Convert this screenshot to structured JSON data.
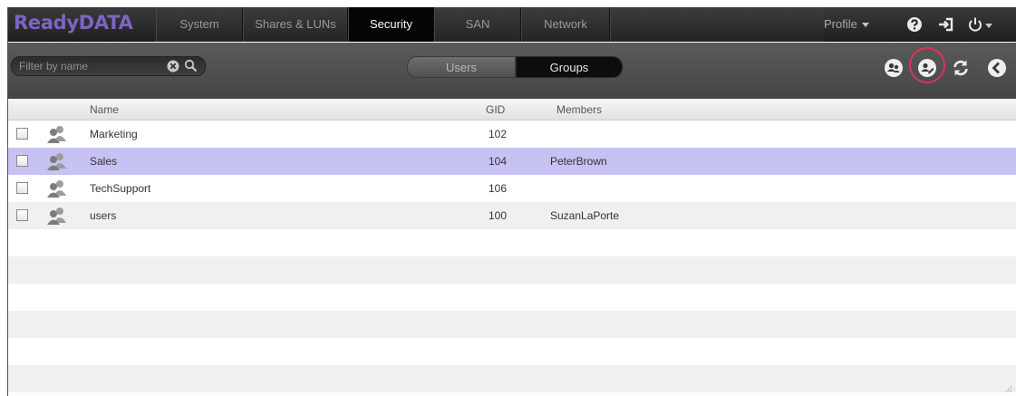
{
  "header": {
    "logo": "ReadyDATA",
    "tabs": [
      {
        "label": "System"
      },
      {
        "label": "Shares & LUNs"
      },
      {
        "label": "Security",
        "active": true
      },
      {
        "label": "SAN"
      },
      {
        "label": "Network"
      }
    ],
    "profile_label": "Profile",
    "icons": [
      "help-icon",
      "logout-icon",
      "power-icon"
    ]
  },
  "toolbar": {
    "filter_placeholder": "Filter by name",
    "segments": {
      "users": "Users",
      "groups": "Groups",
      "selected": "Groups"
    },
    "icons": [
      "new-group-icon",
      "edit-group-icon",
      "refresh-icon",
      "collapse-icon"
    ]
  },
  "table": {
    "columns": {
      "name": "Name",
      "gid": "GID",
      "members": "Members"
    },
    "rows": [
      {
        "name": "Marketing",
        "gid": "102",
        "members": "",
        "selected": false
      },
      {
        "name": "Sales",
        "gid": "104",
        "members": "PeterBrown",
        "selected": true
      },
      {
        "name": "TechSupport",
        "gid": "106",
        "members": "",
        "selected": false
      },
      {
        "name": "users",
        "gid": "100",
        "members": "SuzanLaPorte",
        "selected": false
      }
    ]
  },
  "colors": {
    "brand": "#7f63c4",
    "selected_row": "#c6c2f2",
    "highlight_ring": "#e0325a",
    "topbar": "#2a2a2a",
    "toolbar": "#505050"
  }
}
